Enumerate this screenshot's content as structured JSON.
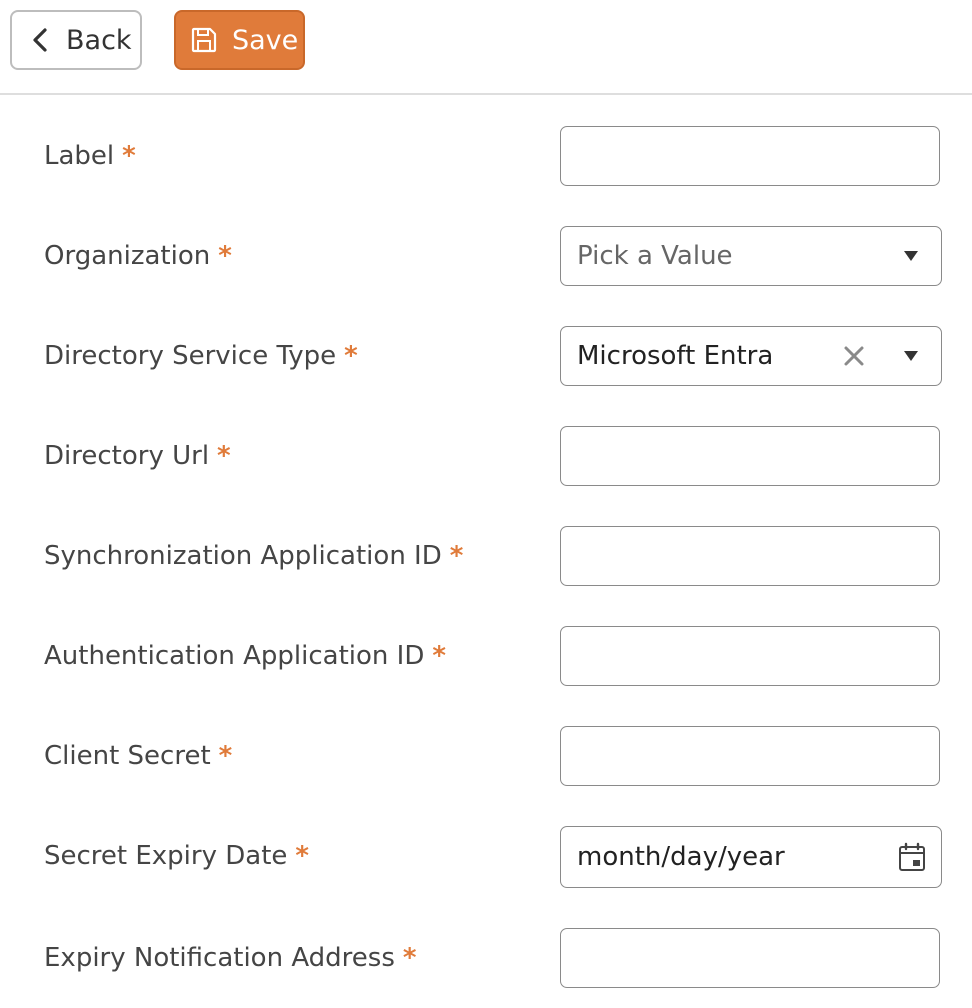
{
  "toolbar": {
    "back_label": "Back",
    "save_label": "Save"
  },
  "colors": {
    "accent": "#e07b3a",
    "required_marker": "#e07b3a",
    "input_border": "#8a8a8a"
  },
  "form": {
    "required_marker": "*",
    "label": {
      "label": "Label",
      "value": ""
    },
    "organization": {
      "label": "Organization",
      "placeholder": "Pick a Value"
    },
    "directory_service_type": {
      "label": "Directory Service Type",
      "value": "Microsoft Entra"
    },
    "directory_url": {
      "label": "Directory Url",
      "value": ""
    },
    "sync_app_id": {
      "label": "Synchronization Application ID",
      "value": ""
    },
    "auth_app_id": {
      "label": "Authentication Application ID",
      "value": ""
    },
    "client_secret": {
      "label": "Client Secret",
      "value": ""
    },
    "secret_expiry_date": {
      "label": "Secret Expiry Date",
      "placeholder": "month/day/year"
    },
    "expiry_notification_address": {
      "label": "Expiry Notification Address",
      "value": ""
    }
  },
  "icons": {
    "back": "chevron-left-icon",
    "save": "floppy-disk-icon",
    "dropdown": "caret-down-icon",
    "clear": "close-icon",
    "calendar": "calendar-icon"
  }
}
